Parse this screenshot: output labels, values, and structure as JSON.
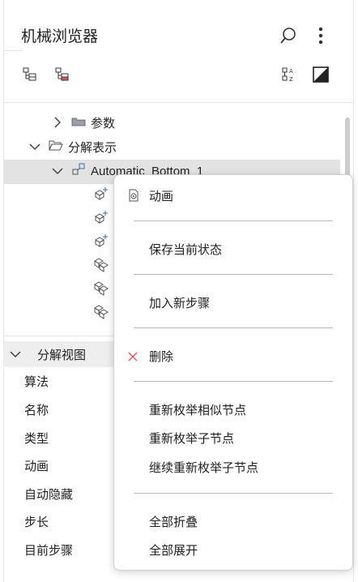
{
  "header": {
    "title": "机械浏览器",
    "icons": [
      "search-icon",
      "more-vertical-icon"
    ]
  },
  "toolbar": {
    "icons": [
      "show-tree-icon",
      "filter-tree-icon",
      "sort-az-icon",
      "contrast-toggle-icon"
    ]
  },
  "tree": {
    "items": [
      {
        "label": "参数",
        "expanded": false,
        "icon": "folder-icon"
      },
      {
        "label": "分解表示",
        "expanded": true,
        "icon": "folder-open-icon"
      },
      {
        "label": "Automatic_Bottom_1",
        "expanded": true,
        "icon": "explode-node-icon",
        "selected": true
      }
    ],
    "child_icons": [
      "step-node-icon",
      "step-node-icon",
      "step-node-icon",
      "part-node-icon",
      "part-node-icon",
      "part-node-icon"
    ]
  },
  "properties": {
    "section_title": "分解视图",
    "labels": [
      "算法",
      "名称",
      "类型",
      "动画",
      "自动隐藏",
      "步长",
      "目前步骤"
    ]
  },
  "context_menu": {
    "items": [
      {
        "label": "动画",
        "icon": "animation-icon"
      },
      {
        "label": "保存当前状态"
      },
      {
        "label": "加入新步骤"
      },
      {
        "label": "删除",
        "icon": "delete-x-icon",
        "icon_color": "#e05a5a"
      },
      {
        "label": "重新枚举相似节点"
      },
      {
        "label": "重新枚举子节点"
      },
      {
        "label": "继续重新枚举子节点"
      },
      {
        "label": "全部折叠"
      },
      {
        "label": "全部展开"
      }
    ]
  },
  "colors": {
    "selection": "#e3e3e3",
    "accent_blue": "#3b6fb6",
    "delete_red": "#e05a5a"
  }
}
